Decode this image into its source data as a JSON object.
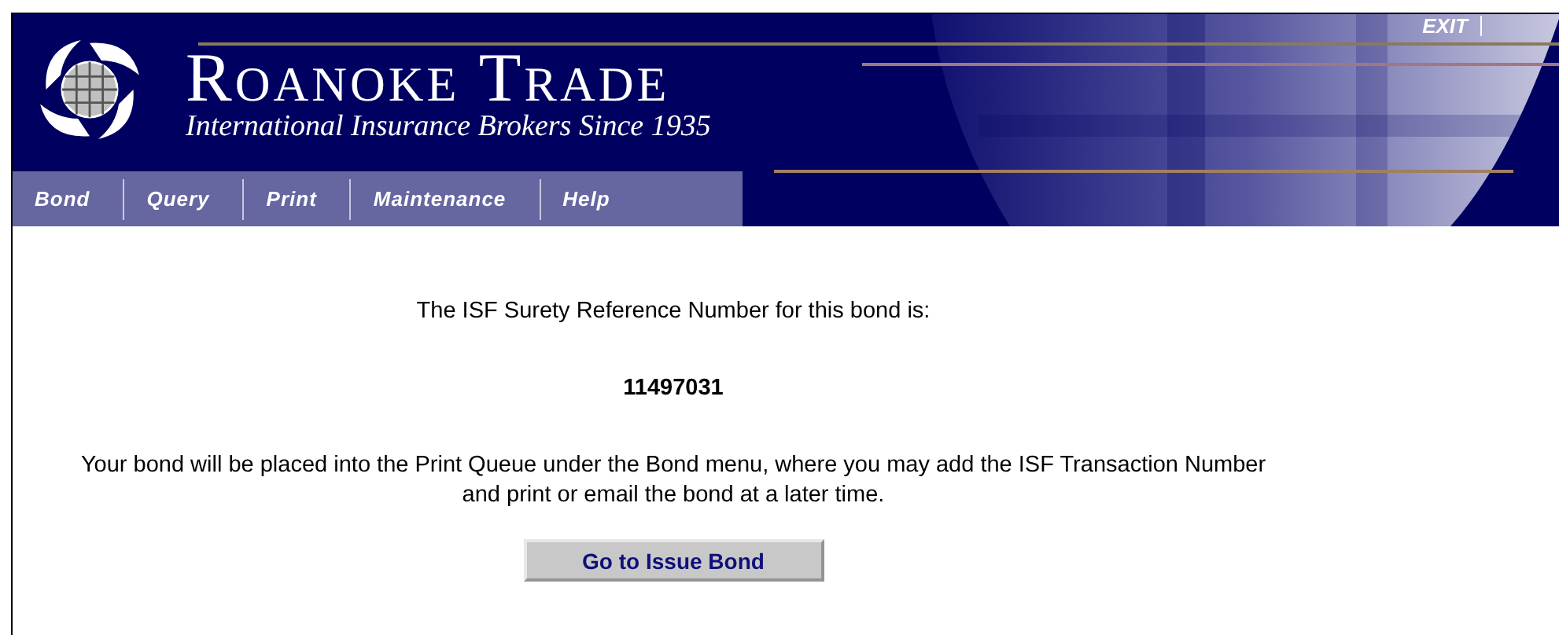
{
  "header": {
    "brand": "Roanoke Trade",
    "tagline": "International Insurance Brokers Since 1935",
    "exit_link": "EXIT"
  },
  "nav": [
    {
      "label": "Bond"
    },
    {
      "label": "Query"
    },
    {
      "label": "Print"
    },
    {
      "label": "Maintenance"
    },
    {
      "label": "Help"
    }
  ],
  "content": {
    "intro": "The ISF Surety Reference Number for this bond is:",
    "reference_number": "11497031",
    "message": "Your bond will be placed into the Print Queue under the Bond menu, where you may add the ISF Transaction Number and print or email the bond at a later time.",
    "button": "Go to Issue Bond"
  }
}
